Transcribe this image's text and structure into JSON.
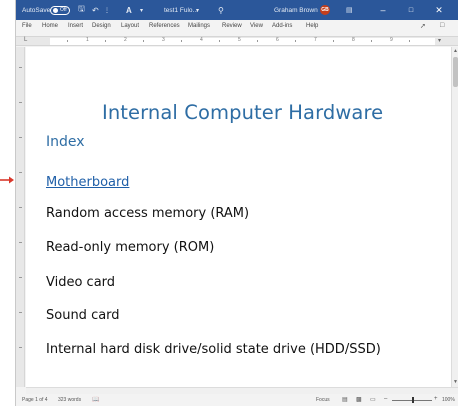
{
  "titlebar": {
    "autosave_label": "AutoSave",
    "autosave_state": "Off",
    "doc_title": "test1 Fulo...",
    "user_name": "Graham Brown",
    "user_initials": "GB",
    "accent": "#2b579a"
  },
  "menu": {
    "items": [
      "File",
      "Home",
      "Insert",
      "Design",
      "Layout",
      "References",
      "Mailings",
      "Review",
      "View",
      "Add-ins",
      "Help"
    ]
  },
  "ruler": {
    "numbers": [
      "1",
      "2",
      "3",
      "4",
      "5",
      "6",
      "7",
      "8",
      "9"
    ]
  },
  "document": {
    "title": "Internal Computer Hardware",
    "heading": "Index",
    "link": "Motherboard",
    "lines": [
      "Random access memory (RAM)",
      "Read-only memory (ROM)",
      "Video card",
      "Sound card",
      "Internal hard disk drive/solid state drive (HDD/SSD)"
    ],
    "heading_color": "#2e6da4",
    "link_color": "#1f5fa8"
  },
  "statusbar": {
    "page": "Page 1 of 4",
    "words": "323 words",
    "focus": "Focus",
    "zoom": "100%"
  },
  "icons": {
    "undo": "undo-icon",
    "save": "save-icon",
    "search": "search-icon",
    "minimize": "minimize-icon",
    "maximize": "maximize-icon",
    "close": "close-icon",
    "share": "share-icon",
    "comments": "comments-icon"
  }
}
